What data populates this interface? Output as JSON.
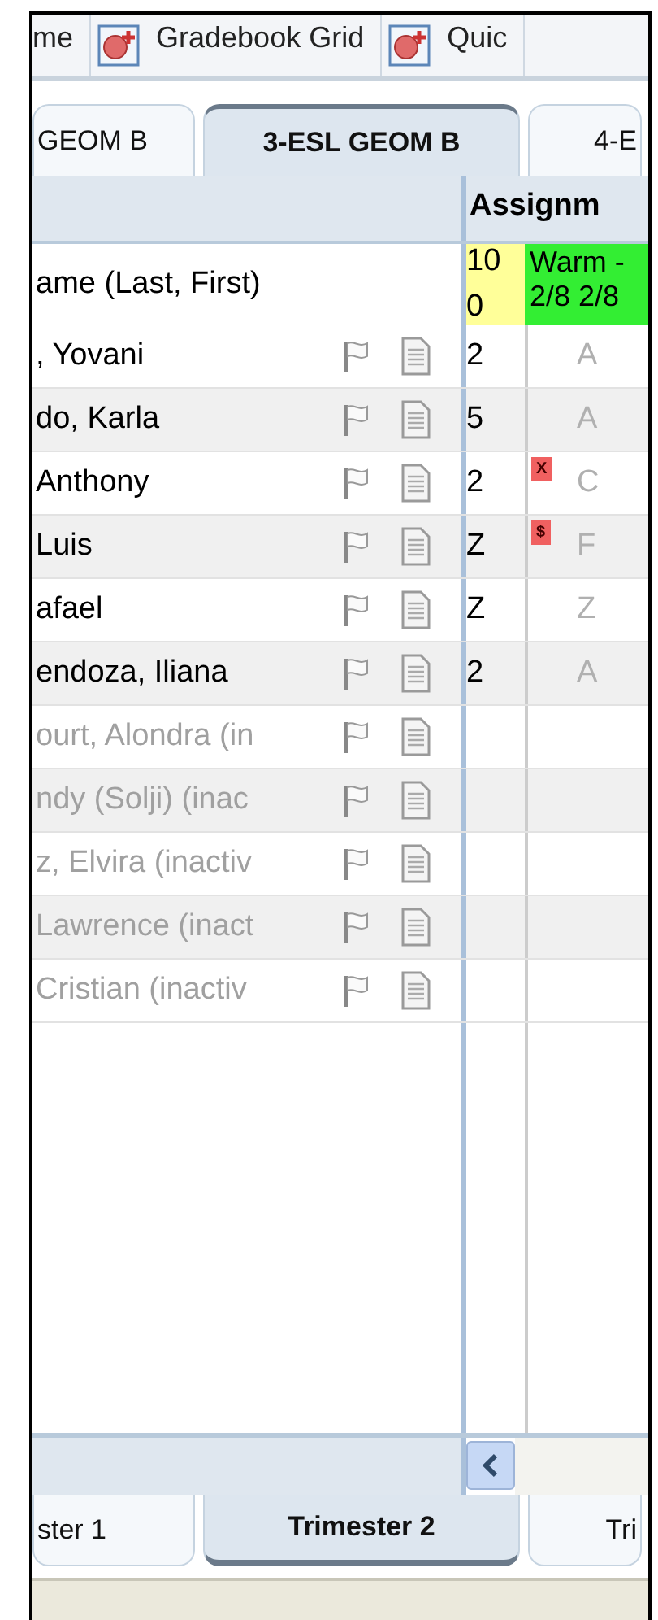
{
  "toolbar": [
    {
      "label": "me",
      "icon": false
    },
    {
      "label": "Gradebook Grid",
      "icon": true
    },
    {
      "label": "Quic",
      "icon": true
    }
  ],
  "class_tabs": [
    {
      "label": "GEOM B",
      "selected": false
    },
    {
      "label": "3-ESL GEOM B",
      "selected": true
    },
    {
      "label": "4-E",
      "selected": false
    }
  ],
  "grid": {
    "group_header": "Assignm",
    "name_header": "ame (Last, First)",
    "score_header": [
      "10",
      "0"
    ],
    "assignment_header": "Warm - 2/8 2/8",
    "rows": [
      {
        "name": ", Yovani",
        "inactive": false,
        "score": "2",
        "grade": "A"
      },
      {
        "name": "do, Karla",
        "inactive": false,
        "score": "5",
        "grade": "A"
      },
      {
        "name": "Anthony",
        "inactive": false,
        "score": "2",
        "grade": "C",
        "marker": "X"
      },
      {
        "name": "Luis",
        "inactive": false,
        "score": "Z",
        "grade": "F",
        "marker": "$"
      },
      {
        "name": "afael",
        "inactive": false,
        "score": "Z",
        "grade": "Z"
      },
      {
        "name": "endoza, Iliana",
        "inactive": false,
        "score": "2",
        "grade": "A"
      },
      {
        "name": "ourt, Alondra (in",
        "inactive": true
      },
      {
        "name": "ndy (Solji) (inac",
        "inactive": true
      },
      {
        "name": "z, Elvira (inactiv",
        "inactive": true
      },
      {
        "name": "Lawrence (inact",
        "inactive": true
      },
      {
        "name": "Cristian (inactiv",
        "inactive": true
      }
    ]
  },
  "term_tabs": [
    {
      "label": "ster 1",
      "selected": false
    },
    {
      "label": "Trimester 2",
      "selected": true
    },
    {
      "label": "Tri",
      "selected": false
    }
  ]
}
